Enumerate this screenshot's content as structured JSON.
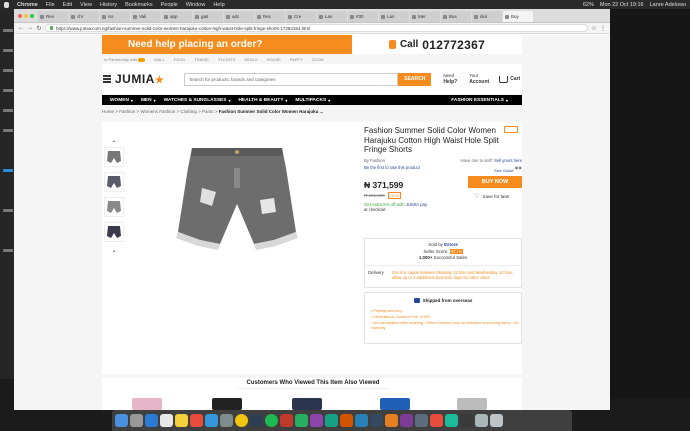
{
  "menubar": {
    "app": "Chrome",
    "items": [
      "File",
      "Edit",
      "View",
      "History",
      "Bookmarks",
      "People",
      "Window",
      "Help"
    ],
    "battery": "62%",
    "clock": "Mon 22 Oct 19:16",
    "user": "Lanre Adelowo"
  },
  "tabs": [
    "Rev",
    "chr",
    "iss",
    "Vali",
    "app",
    "gati",
    "adc",
    "Rec",
    "Cre",
    "Lan",
    "#30",
    "Lan",
    "Mer",
    "Bus",
    "diol",
    "Buy"
  ],
  "address": {
    "url": "https://www.jumia.com.ng/fashion-summer-solid-color-women-harajuku-cotton-high-waist-hole-split-fringe-shorts-17283154.html"
  },
  "banner": {
    "help_text": "Need help placing an order?",
    "call_label": "Call",
    "phone": "012772367"
  },
  "partner_bar": {
    "partnership": "In Partnership with",
    "items": [
      "MALL",
      "FOOD",
      "TRAVEL",
      "FLIGHTS",
      "DEALS",
      "HOUSE",
      "PARTY",
      "ZOOM"
    ]
  },
  "header": {
    "logo": "JUMIA",
    "search_placeholder": "Search for products, brands and categories",
    "search_button": "SEARCH",
    "need_help_top": "Need",
    "need_help_bottom": "Help?",
    "account_top": "Your",
    "account_bottom": "Account",
    "cart_label": "Cart"
  },
  "categories": [
    "WOMEN",
    "MEN",
    "WATCHES & SUNGLASSES",
    "HEALTH & BEAUTY",
    "MULTIPACKS"
  ],
  "categories_right": "FASHION ESSENTIALS",
  "breadcrumbs": {
    "items": [
      "Home",
      "Fashion",
      "Womens Fashion",
      "Clothing",
      "Pants"
    ],
    "current": "Fashion Summer Solid Color Women Harajuku ..."
  },
  "product": {
    "title": "Fashion Summer Solid Color Women Harajuku Cotton High Waist Hole Split Fringe Shorts",
    "brand": "By Fashion",
    "have_one": "Have one to sell?",
    "sell_here": "Sell yours here",
    "rate_text": "Be the first to rate this product",
    "size_guide": "Size Guide",
    "price": "₦ 371,599",
    "old_price": "₦ 421,598",
    "discount": "-12%",
    "cashback": "Get extra 5% off with",
    "pay_label": "JUMIA pay",
    "pay_suffix": "at checkout",
    "buy_now": "BUY NOW",
    "save_later": "Save for later"
  },
  "seller": {
    "sold_by_label": "Sold by",
    "sold_by": "Estore",
    "score_label": "Seller Score:",
    "score": "67 / 5",
    "sales": "1,000+",
    "sales_label": "Successful Sales",
    "delivery_label": "Delivery",
    "delivery_text": "Get it in Lagos between Monday 12 Nov and Wednesday 14 Nov, allow up to 4 additional business days for other cities"
  },
  "overseas": {
    "heading": "Shipped from overseas",
    "bullets": [
      "Prepayment only",
      "International Customs Fee: N 600",
      "No cancellation after ordering - Return allowed only for defective and wrong items - No warranty"
    ]
  },
  "also_viewed": {
    "title": "Customers Who Viewed This Item Also Viewed"
  },
  "colors": {
    "accent": "#f68b1e",
    "link": "#264996",
    "nav_bg": "#000000"
  }
}
